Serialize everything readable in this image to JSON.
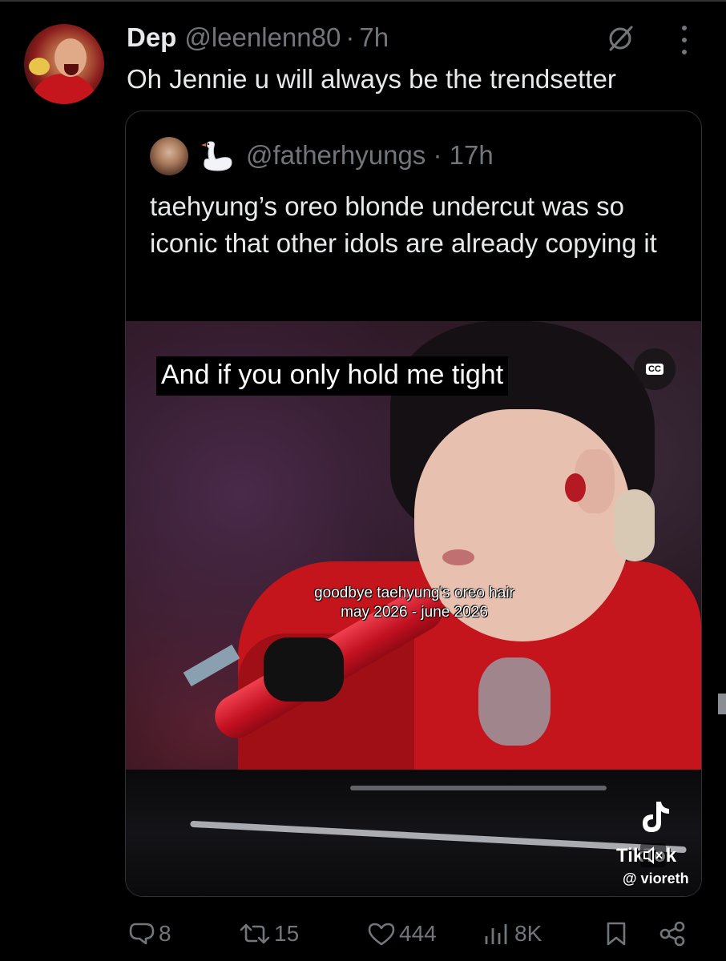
{
  "post": {
    "author_name": "Dep",
    "author_handle": "@leenlenn80",
    "separator": "·",
    "time": "7h",
    "text": "Oh Jennie u will always be the trendsetter"
  },
  "quoted": {
    "handle": "@fatherhyungs",
    "separator": "·",
    "time": "17h",
    "text": "taehyung’s oreo blonde undercut was so iconic that other idols are already copying it",
    "video": {
      "caption": "And if you only hold me tight",
      "cc_label": "CC",
      "overlay_line1": "goodbye taehyung's oreo hair",
      "overlay_line2": "may 2026 - june 2026",
      "watermark": "TikTok",
      "watermark_user": "@ vioreth"
    }
  },
  "actions": {
    "replies": "8",
    "reposts": "15",
    "likes": "444",
    "views": "8K"
  },
  "colors": {
    "background": "#000000",
    "text": "#e7e9ea",
    "muted": "#71767b",
    "border": "#2f3336"
  }
}
